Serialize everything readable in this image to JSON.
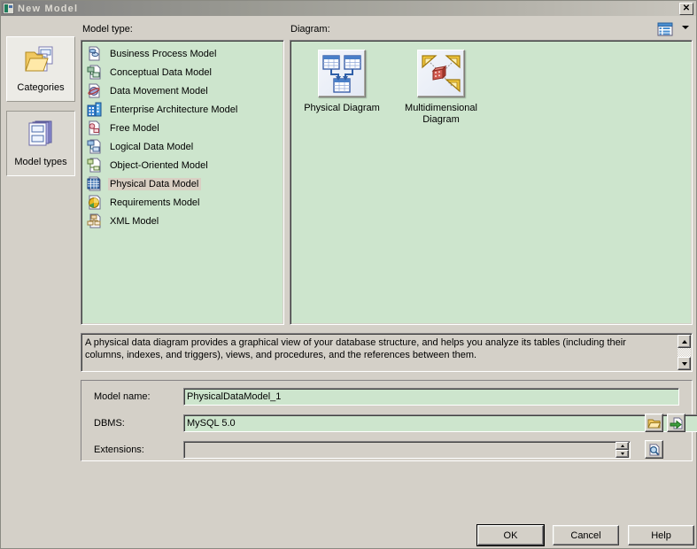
{
  "window": {
    "title": "New Model",
    "icon": "new-model-icon",
    "close_label": "✕"
  },
  "sidebar": {
    "items": [
      {
        "label": "Categories",
        "icon": "folder-documents-icon",
        "selected": false
      },
      {
        "label": "Model types",
        "icon": "stacked-documents-icon",
        "selected": true
      }
    ]
  },
  "model_type": {
    "section_label": "Model type:",
    "items": [
      {
        "label": "Business Process Model",
        "icon": "business-process-model-icon",
        "selected": false
      },
      {
        "label": "Conceptual Data Model",
        "icon": "conceptual-data-model-icon",
        "selected": false
      },
      {
        "label": "Data Movement Model",
        "icon": "data-movement-model-icon",
        "selected": false
      },
      {
        "label": "Enterprise Architecture Model",
        "icon": "enterprise-architecture-model-icon",
        "selected": false
      },
      {
        "label": "Free Model",
        "icon": "free-model-icon",
        "selected": false
      },
      {
        "label": "Logical Data Model",
        "icon": "logical-data-model-icon",
        "selected": false
      },
      {
        "label": "Object-Oriented Model",
        "icon": "object-oriented-model-icon",
        "selected": false
      },
      {
        "label": "Physical Data Model",
        "icon": "physical-data-model-icon",
        "selected": true
      },
      {
        "label": "Requirements Model",
        "icon": "requirements-model-icon",
        "selected": false
      },
      {
        "label": "XML Model",
        "icon": "xml-model-icon",
        "selected": false
      }
    ]
  },
  "diagram": {
    "section_label": "Diagram:",
    "view_toggle_icon": "list-view-icon",
    "view_dropdown_icon": "chevron-down-icon",
    "items": [
      {
        "label": "Physical Diagram",
        "icon": "physical-diagram-icon"
      },
      {
        "label": "Multidimensional Diagram",
        "icon": "multidimensional-diagram-icon"
      }
    ]
  },
  "description": {
    "text": "A physical data diagram provides a graphical view of your database structure, and helps you analyze its tables (including their columns, indexes, and triggers), views, and procedures, and the references between them."
  },
  "form": {
    "model_name": {
      "label": "Model name:",
      "value": "PhysicalDataModel_1",
      "placeholder": ""
    },
    "dbms": {
      "label": "DBMS:",
      "value": "MySQL 5.0",
      "dropdown_icon": "chevron-down-icon",
      "buttons": [
        {
          "name": "browse-dbms-button",
          "icon": "folder-icon"
        },
        {
          "name": "open-dbms-button",
          "icon": "open-document-icon"
        }
      ]
    },
    "extensions": {
      "label": "Extensions:",
      "value": "",
      "spinner_up_icon": "spinner-up-icon",
      "spinner_down_icon": "spinner-down-icon",
      "button": {
        "name": "browse-extensions-button",
        "icon": "magnifier-icon"
      }
    }
  },
  "footer": {
    "buttons": [
      {
        "label": "OK",
        "default": true
      },
      {
        "label": "Cancel",
        "default": false
      },
      {
        "label": "Help",
        "default": false
      }
    ]
  },
  "colors": {
    "panel_green": "#cde5cd",
    "dialog_face": "#d4d0c8",
    "selection_tan": "#d9cfc3",
    "titlebar_gray": "#999992"
  }
}
